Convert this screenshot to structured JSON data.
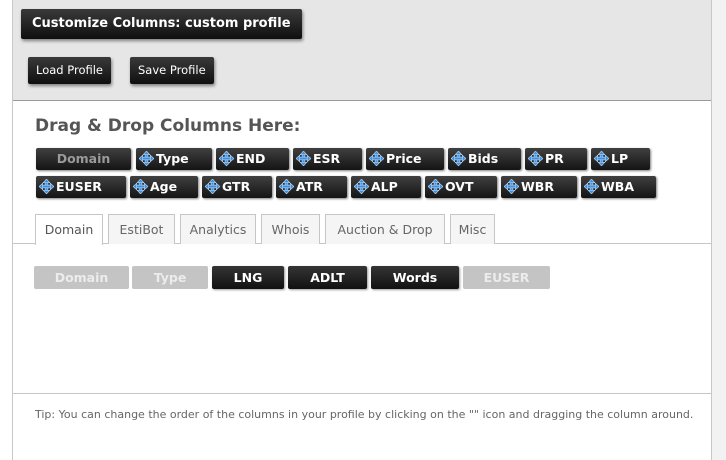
{
  "dialog": {
    "title": "Customize Columns: custom profile",
    "buttons": {
      "load_profile": "Load Profile",
      "save_profile": "Save Profile"
    }
  },
  "drop_area": {
    "heading": "Drag & Drop Columns Here:",
    "chips": [
      {
        "label": "Domain",
        "locked": true
      },
      {
        "label": "Type"
      },
      {
        "label": "END"
      },
      {
        "label": "ESR"
      },
      {
        "label": "Price"
      },
      {
        "label": "Bids"
      },
      {
        "label": "PR"
      },
      {
        "label": "LP"
      },
      {
        "label": "EUSER"
      },
      {
        "label": "Age"
      },
      {
        "label": "GTR"
      },
      {
        "label": "ATR"
      },
      {
        "label": "ALP"
      },
      {
        "label": "OVT"
      },
      {
        "label": "WBR"
      },
      {
        "label": "WBA"
      }
    ]
  },
  "tabs": [
    {
      "label": "Domain",
      "active": true
    },
    {
      "label": "EstiBot"
    },
    {
      "label": "Analytics"
    },
    {
      "label": "Whois"
    },
    {
      "label": "Auction & Drop"
    },
    {
      "label": "Misc"
    }
  ],
  "tab_columns": [
    {
      "label": "Domain",
      "state": "used"
    },
    {
      "label": "Type",
      "state": "used"
    },
    {
      "label": "LNG",
      "state": "available"
    },
    {
      "label": "ADLT",
      "state": "available"
    },
    {
      "label": "Words",
      "state": "available"
    },
    {
      "label": "EUSER",
      "state": "used"
    }
  ],
  "tip": "Tip: You can change the order of the columns in your profile by clicking on the \"\" icon and dragging the column around.",
  "colors": {
    "button_dark": "#1a1a1a",
    "move_icon_blue": "#3d8fe0",
    "header_bg": "#e6e6e6"
  },
  "icons": {
    "chip_handle": "move-arrows-icon"
  }
}
